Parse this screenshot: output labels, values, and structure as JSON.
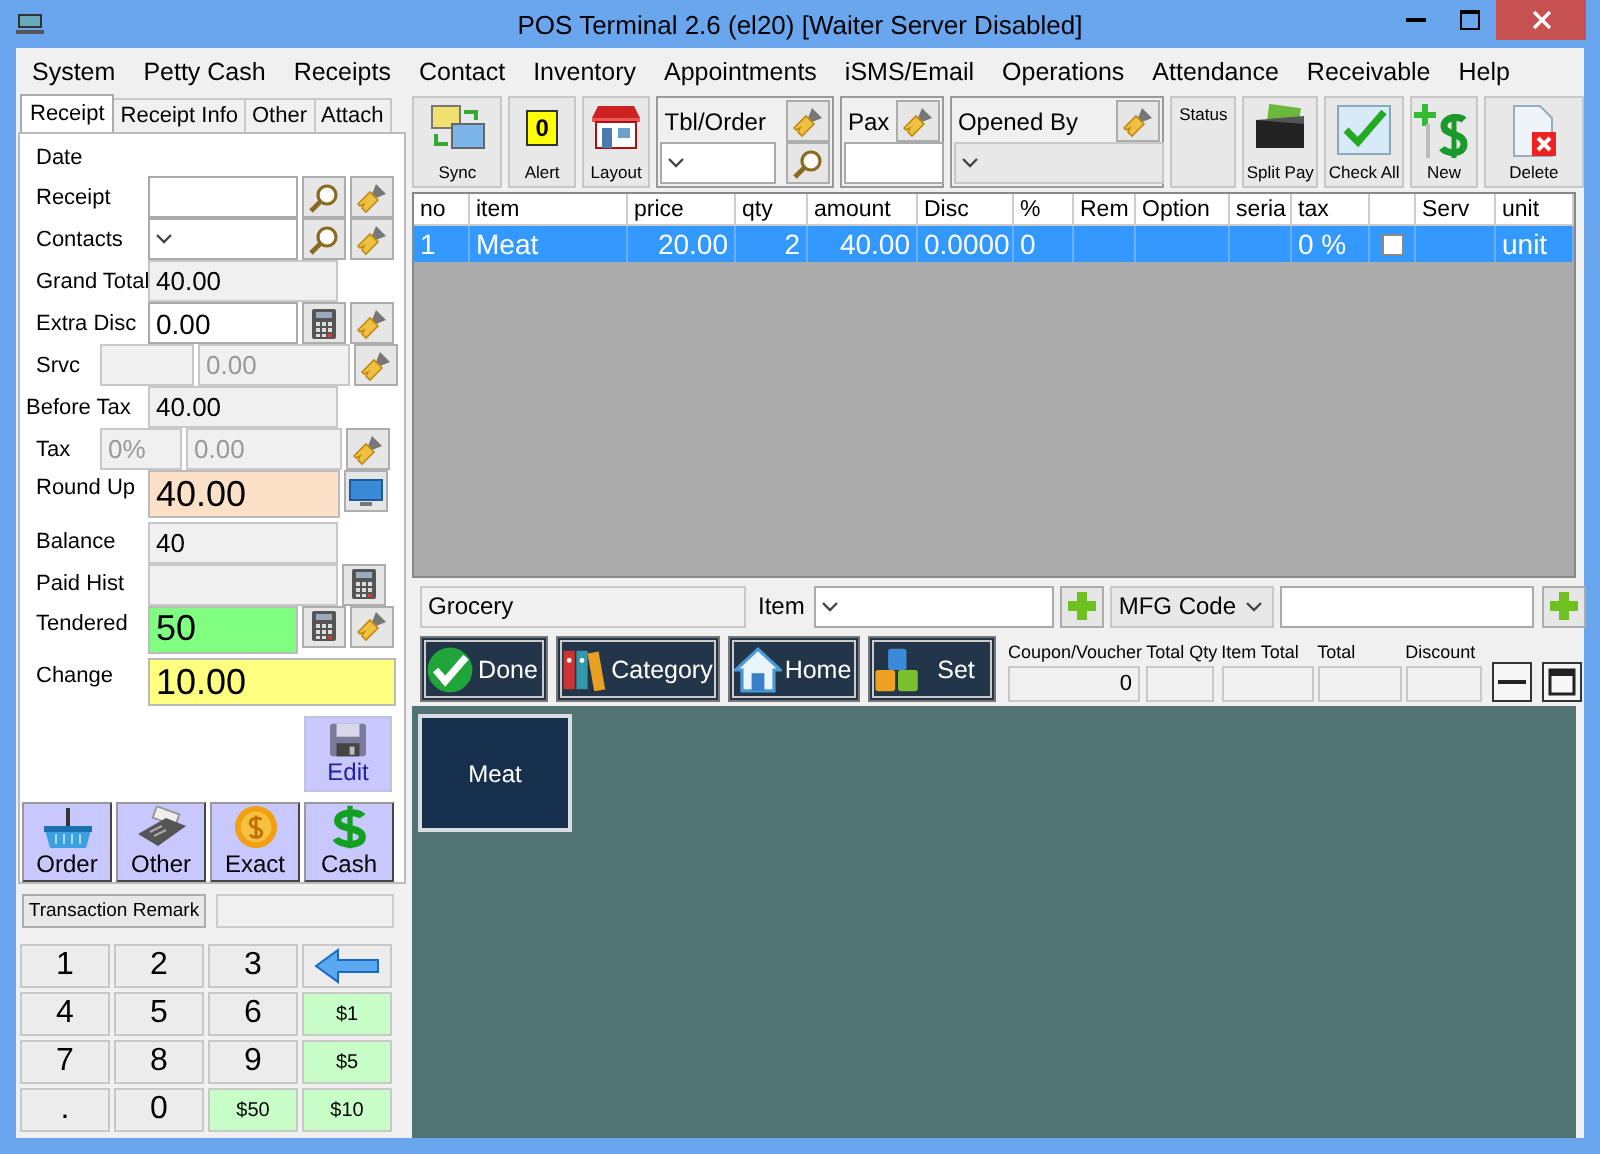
{
  "window": {
    "title": "POS Terminal 2.6 (el20) [Waiter Server Disabled]"
  },
  "menu": [
    "System",
    "Petty Cash",
    "Receipts",
    "Contact",
    "Inventory",
    "Appointments",
    "iSMS/Email",
    "Operations",
    "Attendance",
    "Receivable",
    "Help"
  ],
  "left_tabs": [
    {
      "label": "Receipt",
      "selected": true
    },
    {
      "label": "Receipt Info",
      "selected": false
    },
    {
      "label": "Other",
      "selected": false
    },
    {
      "label": "Attach",
      "selected": false
    }
  ],
  "receipt_form": [
    {
      "kind": "date",
      "label": "Date"
    },
    {
      "kind": "search",
      "label": "Receipt"
    },
    {
      "kind": "lookup",
      "label": "Contacts"
    },
    {
      "kind": "total",
      "label": "Grand Total",
      "value": "40.00"
    },
    {
      "kind": "amount",
      "label": "Extra Disc",
      "value": "0.00"
    },
    {
      "kind": "service",
      "label": "Srvc",
      "value": "0.00",
      "disabled": true
    },
    {
      "kind": "subtotal",
      "label": "Before Tax",
      "value": "40.00"
    },
    {
      "kind": "tax",
      "label": "Tax",
      "rate": "0%",
      "value": "0.00",
      "disabled": true
    },
    {
      "kind": "round_up",
      "label": "Round Up",
      "value": "40.00"
    },
    {
      "kind": "balance",
      "label": "Balance",
      "value": "40"
    },
    {
      "kind": "paid",
      "label": "Paid Hist"
    },
    {
      "kind": "tendered",
      "label": "Tendered",
      "value": "50"
    },
    {
      "kind": "change",
      "label": "Change",
      "value": "10.00"
    }
  ],
  "edit_button": "Edit",
  "payment_buttons": [
    {
      "kind": "order",
      "label": "Order"
    },
    {
      "kind": "other",
      "label": "Other"
    },
    {
      "kind": "exact",
      "label": "Exact"
    },
    {
      "kind": "cash",
      "label": "Cash"
    }
  ],
  "remark": {
    "button": "Transaction Remark"
  },
  "keypad": [
    {
      "kind": "digit",
      "label": "1"
    },
    {
      "kind": "digit",
      "label": "2"
    },
    {
      "kind": "digit",
      "label": "3"
    },
    {
      "kind": "back"
    },
    {
      "kind": "digit",
      "label": "4"
    },
    {
      "kind": "digit",
      "label": "5"
    },
    {
      "kind": "digit",
      "label": "6"
    },
    {
      "kind": "cash",
      "label": "$1"
    },
    {
      "kind": "digit",
      "label": "7"
    },
    {
      "kind": "digit",
      "label": "8"
    },
    {
      "kind": "digit",
      "label": "9"
    },
    {
      "kind": "cash",
      "label": "$5"
    },
    {
      "kind": "digit",
      "label": "."
    },
    {
      "kind": "digit",
      "label": "0"
    },
    {
      "kind": "cash",
      "label": "$50"
    },
    {
      "kind": "cash",
      "label": "$10"
    }
  ],
  "toolbar": [
    {
      "kind": "sync",
      "label": "Sync"
    },
    {
      "kind": "alert",
      "label": "Alert",
      "badge": "0"
    },
    {
      "kind": "layout",
      "label": "Layout"
    },
    {
      "kind": "table_order",
      "label": "Tbl/Order"
    },
    {
      "kind": "pax",
      "label": "Pax"
    },
    {
      "kind": "opened_by",
      "label": "Opened By"
    },
    {
      "kind": "status",
      "label": "Status"
    },
    {
      "kind": "split",
      "label": "Split Pay"
    },
    {
      "kind": "check",
      "label": "Check All"
    },
    {
      "kind": "new",
      "label": "New"
    },
    {
      "kind": "delete",
      "label": "Delete"
    }
  ],
  "table": {
    "columns": [
      {
        "label": "no"
      },
      {
        "label": "item"
      },
      {
        "label": "price"
      },
      {
        "label": "qty"
      },
      {
        "label": "amount"
      },
      {
        "label": "Disc"
      },
      {
        "label": "%"
      },
      {
        "label": "Rem"
      },
      {
        "label": "Option"
      },
      {
        "label": "seria"
      },
      {
        "label": "tax"
      },
      {
        "kind": "checkbox"
      },
      {
        "label": "Serv"
      },
      {
        "label": "unit"
      }
    ],
    "rows": [
      {
        "selected": true,
        "checked": false,
        "no": "1",
        "item": "Meat",
        "price": "20.00",
        "qty": "2",
        "amount": "40.00",
        "disc": "0.0000",
        "percent": "0",
        "tax": "0 %",
        "unit": "unit"
      }
    ]
  },
  "entry": {
    "category": "Grocery",
    "item_label": "Item",
    "code_type": "MFG Code"
  },
  "nav_buttons": [
    {
      "kind": "done",
      "label": "Done"
    },
    {
      "kind": "category",
      "label": "Category"
    },
    {
      "kind": "home",
      "label": "Home"
    },
    {
      "kind": "set",
      "label": "Set"
    }
  ],
  "totals": [
    {
      "label": "Coupon/Voucher",
      "value": "0"
    },
    {
      "label": "Total Qty"
    },
    {
      "label": "Item Total"
    },
    {
      "label": "Total"
    },
    {
      "label": "Discount"
    }
  ],
  "tiles": [
    {
      "label": "Meat"
    }
  ]
}
